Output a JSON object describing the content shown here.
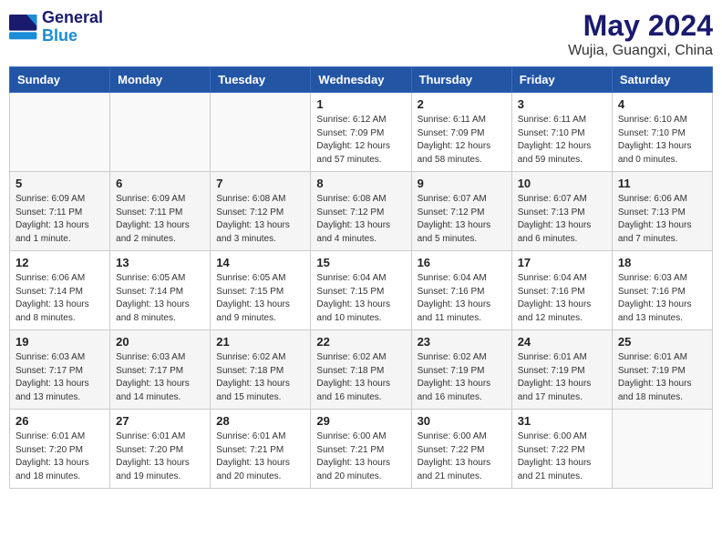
{
  "header": {
    "logo_line1": "General",
    "logo_line2": "Blue",
    "title": "May 2024",
    "subtitle": "Wujia, Guangxi, China"
  },
  "weekdays": [
    "Sunday",
    "Monday",
    "Tuesday",
    "Wednesday",
    "Thursday",
    "Friday",
    "Saturday"
  ],
  "weeks": [
    [
      {
        "day": "",
        "sunrise": "",
        "sunset": "",
        "daylight": ""
      },
      {
        "day": "",
        "sunrise": "",
        "sunset": "",
        "daylight": ""
      },
      {
        "day": "",
        "sunrise": "",
        "sunset": "",
        "daylight": ""
      },
      {
        "day": "1",
        "sunrise": "Sunrise: 6:12 AM",
        "sunset": "Sunset: 7:09 PM",
        "daylight": "Daylight: 12 hours and 57 minutes."
      },
      {
        "day": "2",
        "sunrise": "Sunrise: 6:11 AM",
        "sunset": "Sunset: 7:09 PM",
        "daylight": "Daylight: 12 hours and 58 minutes."
      },
      {
        "day": "3",
        "sunrise": "Sunrise: 6:11 AM",
        "sunset": "Sunset: 7:10 PM",
        "daylight": "Daylight: 12 hours and 59 minutes."
      },
      {
        "day": "4",
        "sunrise": "Sunrise: 6:10 AM",
        "sunset": "Sunset: 7:10 PM",
        "daylight": "Daylight: 13 hours and 0 minutes."
      }
    ],
    [
      {
        "day": "5",
        "sunrise": "Sunrise: 6:09 AM",
        "sunset": "Sunset: 7:11 PM",
        "daylight": "Daylight: 13 hours and 1 minute."
      },
      {
        "day": "6",
        "sunrise": "Sunrise: 6:09 AM",
        "sunset": "Sunset: 7:11 PM",
        "daylight": "Daylight: 13 hours and 2 minutes."
      },
      {
        "day": "7",
        "sunrise": "Sunrise: 6:08 AM",
        "sunset": "Sunset: 7:12 PM",
        "daylight": "Daylight: 13 hours and 3 minutes."
      },
      {
        "day": "8",
        "sunrise": "Sunrise: 6:08 AM",
        "sunset": "Sunset: 7:12 PM",
        "daylight": "Daylight: 13 hours and 4 minutes."
      },
      {
        "day": "9",
        "sunrise": "Sunrise: 6:07 AM",
        "sunset": "Sunset: 7:12 PM",
        "daylight": "Daylight: 13 hours and 5 minutes."
      },
      {
        "day": "10",
        "sunrise": "Sunrise: 6:07 AM",
        "sunset": "Sunset: 7:13 PM",
        "daylight": "Daylight: 13 hours and 6 minutes."
      },
      {
        "day": "11",
        "sunrise": "Sunrise: 6:06 AM",
        "sunset": "Sunset: 7:13 PM",
        "daylight": "Daylight: 13 hours and 7 minutes."
      }
    ],
    [
      {
        "day": "12",
        "sunrise": "Sunrise: 6:06 AM",
        "sunset": "Sunset: 7:14 PM",
        "daylight": "Daylight: 13 hours and 8 minutes."
      },
      {
        "day": "13",
        "sunrise": "Sunrise: 6:05 AM",
        "sunset": "Sunset: 7:14 PM",
        "daylight": "Daylight: 13 hours and 8 minutes."
      },
      {
        "day": "14",
        "sunrise": "Sunrise: 6:05 AM",
        "sunset": "Sunset: 7:15 PM",
        "daylight": "Daylight: 13 hours and 9 minutes."
      },
      {
        "day": "15",
        "sunrise": "Sunrise: 6:04 AM",
        "sunset": "Sunset: 7:15 PM",
        "daylight": "Daylight: 13 hours and 10 minutes."
      },
      {
        "day": "16",
        "sunrise": "Sunrise: 6:04 AM",
        "sunset": "Sunset: 7:16 PM",
        "daylight": "Daylight: 13 hours and 11 minutes."
      },
      {
        "day": "17",
        "sunrise": "Sunrise: 6:04 AM",
        "sunset": "Sunset: 7:16 PM",
        "daylight": "Daylight: 13 hours and 12 minutes."
      },
      {
        "day": "18",
        "sunrise": "Sunrise: 6:03 AM",
        "sunset": "Sunset: 7:16 PM",
        "daylight": "Daylight: 13 hours and 13 minutes."
      }
    ],
    [
      {
        "day": "19",
        "sunrise": "Sunrise: 6:03 AM",
        "sunset": "Sunset: 7:17 PM",
        "daylight": "Daylight: 13 hours and 13 minutes."
      },
      {
        "day": "20",
        "sunrise": "Sunrise: 6:03 AM",
        "sunset": "Sunset: 7:17 PM",
        "daylight": "Daylight: 13 hours and 14 minutes."
      },
      {
        "day": "21",
        "sunrise": "Sunrise: 6:02 AM",
        "sunset": "Sunset: 7:18 PM",
        "daylight": "Daylight: 13 hours and 15 minutes."
      },
      {
        "day": "22",
        "sunrise": "Sunrise: 6:02 AM",
        "sunset": "Sunset: 7:18 PM",
        "daylight": "Daylight: 13 hours and 16 minutes."
      },
      {
        "day": "23",
        "sunrise": "Sunrise: 6:02 AM",
        "sunset": "Sunset: 7:19 PM",
        "daylight": "Daylight: 13 hours and 16 minutes."
      },
      {
        "day": "24",
        "sunrise": "Sunrise: 6:01 AM",
        "sunset": "Sunset: 7:19 PM",
        "daylight": "Daylight: 13 hours and 17 minutes."
      },
      {
        "day": "25",
        "sunrise": "Sunrise: 6:01 AM",
        "sunset": "Sunset: 7:19 PM",
        "daylight": "Daylight: 13 hours and 18 minutes."
      }
    ],
    [
      {
        "day": "26",
        "sunrise": "Sunrise: 6:01 AM",
        "sunset": "Sunset: 7:20 PM",
        "daylight": "Daylight: 13 hours and 18 minutes."
      },
      {
        "day": "27",
        "sunrise": "Sunrise: 6:01 AM",
        "sunset": "Sunset: 7:20 PM",
        "daylight": "Daylight: 13 hours and 19 minutes."
      },
      {
        "day": "28",
        "sunrise": "Sunrise: 6:01 AM",
        "sunset": "Sunset: 7:21 PM",
        "daylight": "Daylight: 13 hours and 20 minutes."
      },
      {
        "day": "29",
        "sunrise": "Sunrise: 6:00 AM",
        "sunset": "Sunset: 7:21 PM",
        "daylight": "Daylight: 13 hours and 20 minutes."
      },
      {
        "day": "30",
        "sunrise": "Sunrise: 6:00 AM",
        "sunset": "Sunset: 7:22 PM",
        "daylight": "Daylight: 13 hours and 21 minutes."
      },
      {
        "day": "31",
        "sunrise": "Sunrise: 6:00 AM",
        "sunset": "Sunset: 7:22 PM",
        "daylight": "Daylight: 13 hours and 21 minutes."
      },
      {
        "day": "",
        "sunrise": "",
        "sunset": "",
        "daylight": ""
      }
    ]
  ]
}
